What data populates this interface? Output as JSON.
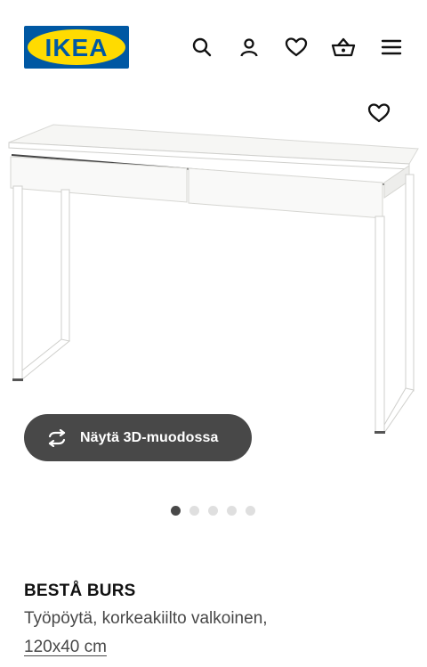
{
  "header": {
    "logo_text": "IKEA",
    "icons": [
      "search-icon",
      "account-icon",
      "heart-icon",
      "basket-icon",
      "menu-icon"
    ]
  },
  "product_image": {
    "favourite_icon": "heart-icon",
    "view_3d_label": "Näytä 3D-muodossa",
    "view_3d_icon": "rotate-3d-icon"
  },
  "carousel": {
    "total": 5,
    "active": 1
  },
  "product": {
    "name": "BESTÅ BURS",
    "description": "Työpöytä, korkeakiilto valkoinen,",
    "size": "120x40 cm"
  },
  "colors": {
    "logo_blue": "#0058a3",
    "logo_yellow": "#ffdb00",
    "button_dark": "#484848"
  }
}
